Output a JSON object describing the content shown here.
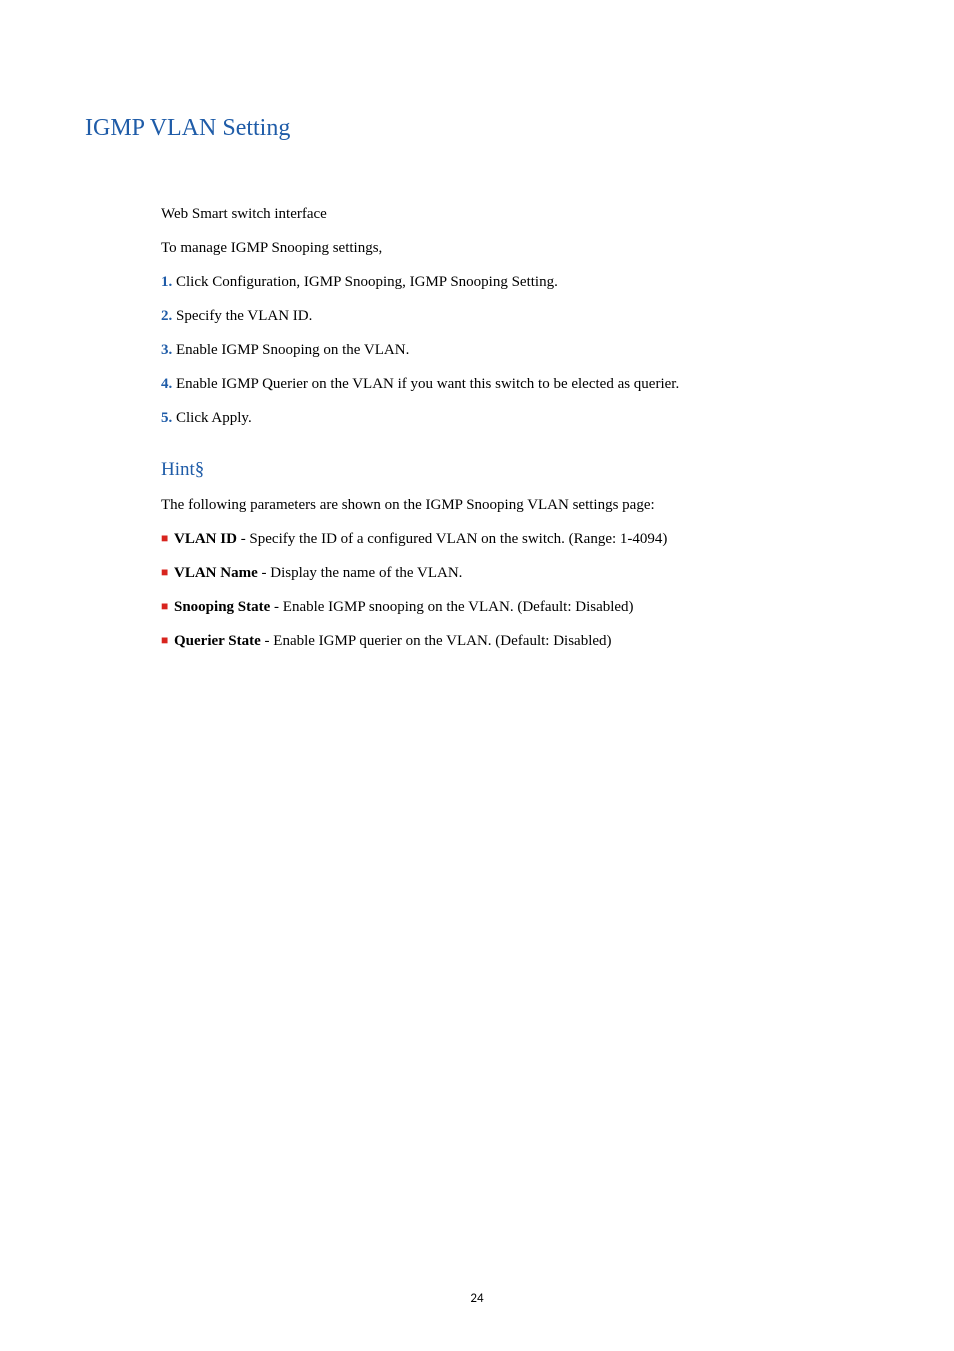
{
  "heading": "IGMP VLAN Setting",
  "intro1": "Web Smart switch interface",
  "intro2": "To manage IGMP Snooping settings,",
  "steps": [
    {
      "num": "1.",
      "text": " Click Configuration, IGMP Snooping, IGMP Snooping Setting."
    },
    {
      "num": "2.",
      "text": " Specify the VLAN ID."
    },
    {
      "num": "3.",
      "text": " Enable IGMP Snooping on the VLAN."
    },
    {
      "num": "4.",
      "text": " Enable IGMP Querier on the VLAN if you want this switch to be elected as querier."
    },
    {
      "num": "5.",
      "text": " Click Apply."
    }
  ],
  "hint_heading": "Hint§",
  "hint_intro": "The following parameters are shown on the IGMP Snooping VLAN settings page:",
  "bullets": [
    {
      "term": "VLAN ID",
      "desc": " - Specify the ID of a configured VLAN on the switch. (Range: 1-4094)"
    },
    {
      "term": "VLAN Name",
      "desc": " - Display the name of the VLAN."
    },
    {
      "term": "Snooping State",
      "desc": " - Enable IGMP snooping on the VLAN. (Default: Disabled)"
    },
    {
      "term": "Querier State",
      "desc": " - Enable IGMP querier on the VLAN. (Default: Disabled)"
    }
  ],
  "page_number": "24",
  "bullet_glyph": "■"
}
